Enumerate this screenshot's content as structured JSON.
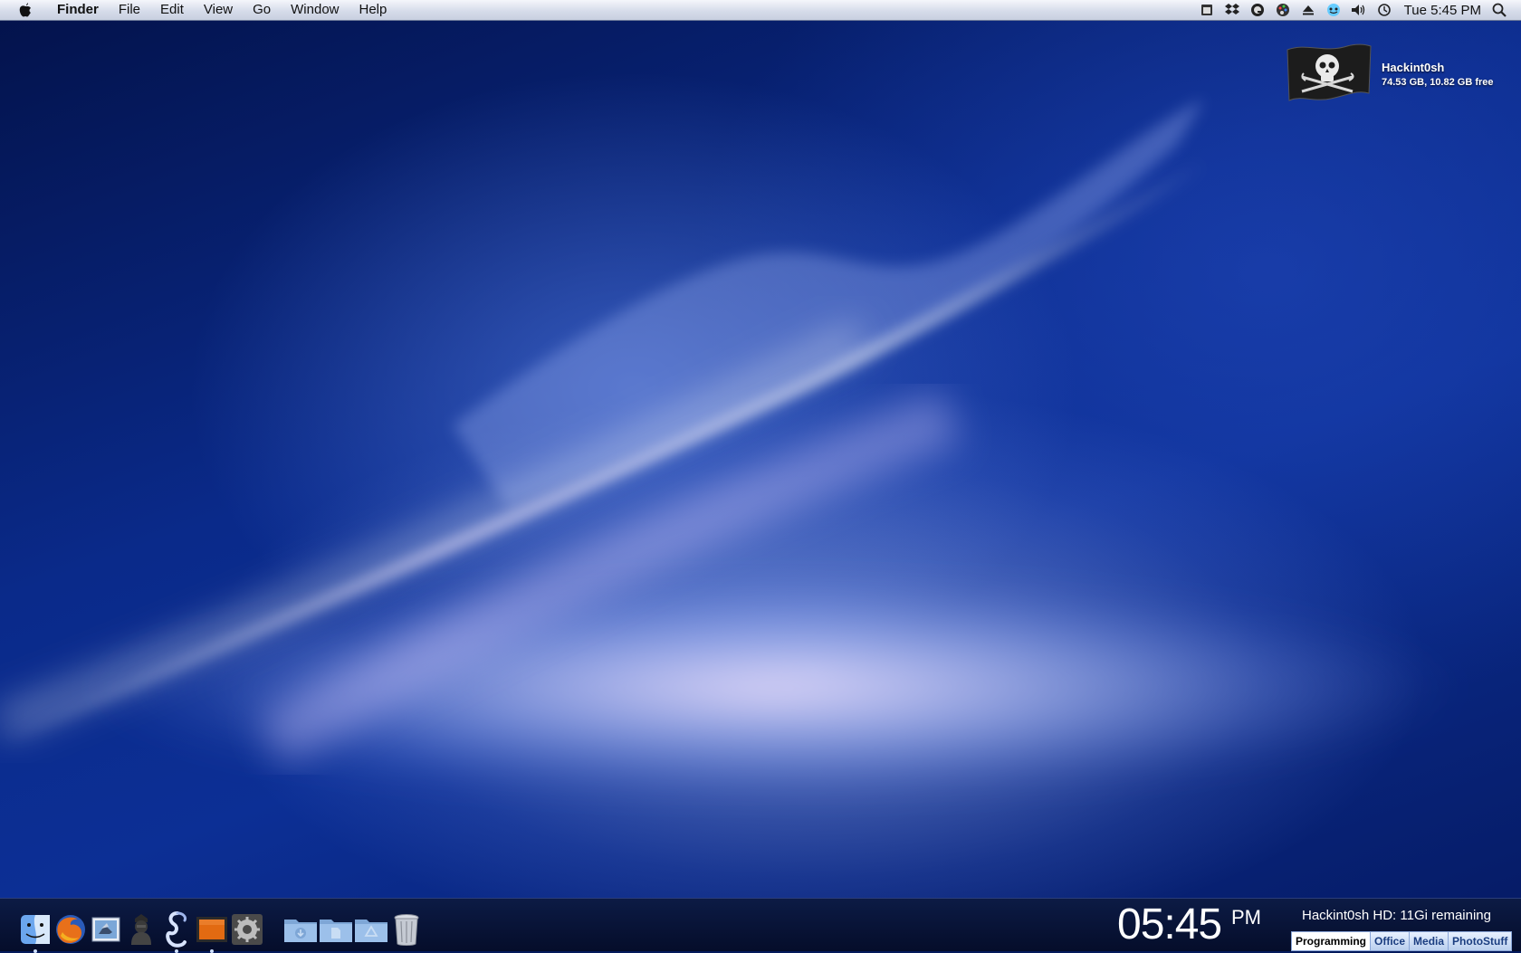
{
  "menubar": {
    "app_name": "Finder",
    "menus": [
      "File",
      "Edit",
      "View",
      "Go",
      "Window",
      "Help"
    ],
    "status_icons": [
      "window-icon",
      "dropbox-icon",
      "quicksilver-icon",
      "color-palette-icon",
      "eject-icon",
      "chat-icon",
      "volume-icon",
      "time-machine-icon"
    ],
    "clock": "Tue 5:45 PM"
  },
  "desktop": {
    "drive": {
      "name": "Hackint0sh",
      "info": "74.53 GB, 10.82 GB free",
      "icon": "pirate-flag-icon"
    }
  },
  "dock": {
    "items": [
      {
        "name": "finder-icon",
        "running": true
      },
      {
        "name": "firefox-icon",
        "running": false
      },
      {
        "name": "mail-icon",
        "running": false
      },
      {
        "name": "adium-icon",
        "running": false
      },
      {
        "name": "script-editor-icon",
        "running": true
      },
      {
        "name": "media-app-icon",
        "running": true
      },
      {
        "name": "system-preferences-icon",
        "running": false
      }
    ],
    "folders": [
      "downloads-folder-icon",
      "documents-folder-icon",
      "applications-folder-icon"
    ],
    "trash": "trash-icon"
  },
  "bottom": {
    "clock_time": "05:45",
    "clock_ampm": "PM",
    "hd_status": "Hackint0sh HD: 11Gi remaining",
    "spaces": [
      "Programming",
      "Office",
      "Media",
      "PhotoStuff"
    ],
    "active_space": "Programming"
  }
}
